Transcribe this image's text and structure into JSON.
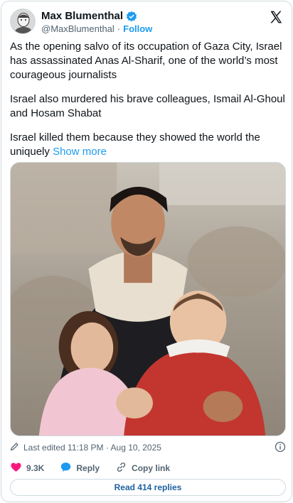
{
  "author": {
    "display_name": "Max Blumenthal",
    "handle": "@MaxBlumenthal",
    "separator": "·",
    "follow_label": "Follow",
    "verified_color": "#1d9bf0"
  },
  "tweet": {
    "paragraphs": [
      "As the opening salvo of its occupation of Gaza City, Israel has assassinated Anas Al-Sharif, one of the world’s most courageous journalists",
      "Israel also murdered his brave colleagues, Ismail Al-Ghoul and Hosam Shabat",
      "Israel killed them because they showed the world the uniquely"
    ],
    "show_more_label": "Show more"
  },
  "media": {
    "description_icon": "photo"
  },
  "meta": {
    "edited_label": "Last edited 11:18 PM · Aug 10, 2025"
  },
  "actions": {
    "like_count": "9.3K",
    "like_color": "#f91880",
    "reply_label": "Reply",
    "reply_color": "#1d9bf0",
    "copy_link_label": "Copy link"
  },
  "footer": {
    "read_replies_label": "Read 414 replies"
  },
  "icons": [
    "avatar",
    "verified-icon",
    "x-logo-icon",
    "pencil-icon",
    "info-icon",
    "heart-icon",
    "reply-bubble-icon",
    "link-icon"
  ]
}
